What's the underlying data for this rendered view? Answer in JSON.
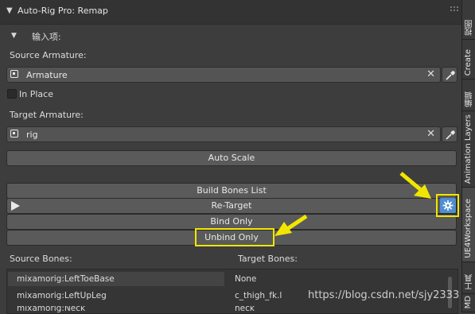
{
  "panel": {
    "title": "Auto-Rig Pro: Remap",
    "collapse_glyph": "▼"
  },
  "input_section": {
    "label": "输入项:",
    "collapse_glyph": "▼"
  },
  "source_armature": {
    "label": "Source Armature:",
    "value": "Armature"
  },
  "in_place": {
    "label": "In Place",
    "checked": false
  },
  "target_armature": {
    "label": "Target Armature:",
    "value": "rig"
  },
  "buttons": {
    "auto_scale": "Auto Scale",
    "build_bones_list": "Build Bones List",
    "re_target": "Re-Target",
    "bind_only": "Bind Only",
    "unbind_only": "Unbind Only"
  },
  "bones": {
    "source_header": "Source Bones:",
    "target_header": "Target Bones:",
    "rows": [
      {
        "source": "mixamorig:LeftToeBase",
        "target": "None"
      },
      {
        "source": "mixamorig:LeftUpLeg",
        "target": "c_thigh_fk.l"
      },
      {
        "source": "mixamorig:Neck",
        "target": "neck"
      }
    ]
  },
  "sidebar_tabs": [
    "视图",
    "Create",
    "编辑",
    "Animation Layers",
    "UE4Workspace",
    "工具",
    "MD"
  ],
  "watermark": "https://blog.csdn.net/sjy2333",
  "colors": {
    "highlight": "#f2e600",
    "accent": "#4f8fd0"
  },
  "icons": [
    "object-data-icon",
    "eyedropper-icon",
    "close-icon",
    "play-icon",
    "gear-icon",
    "arrow-annotation"
  ]
}
